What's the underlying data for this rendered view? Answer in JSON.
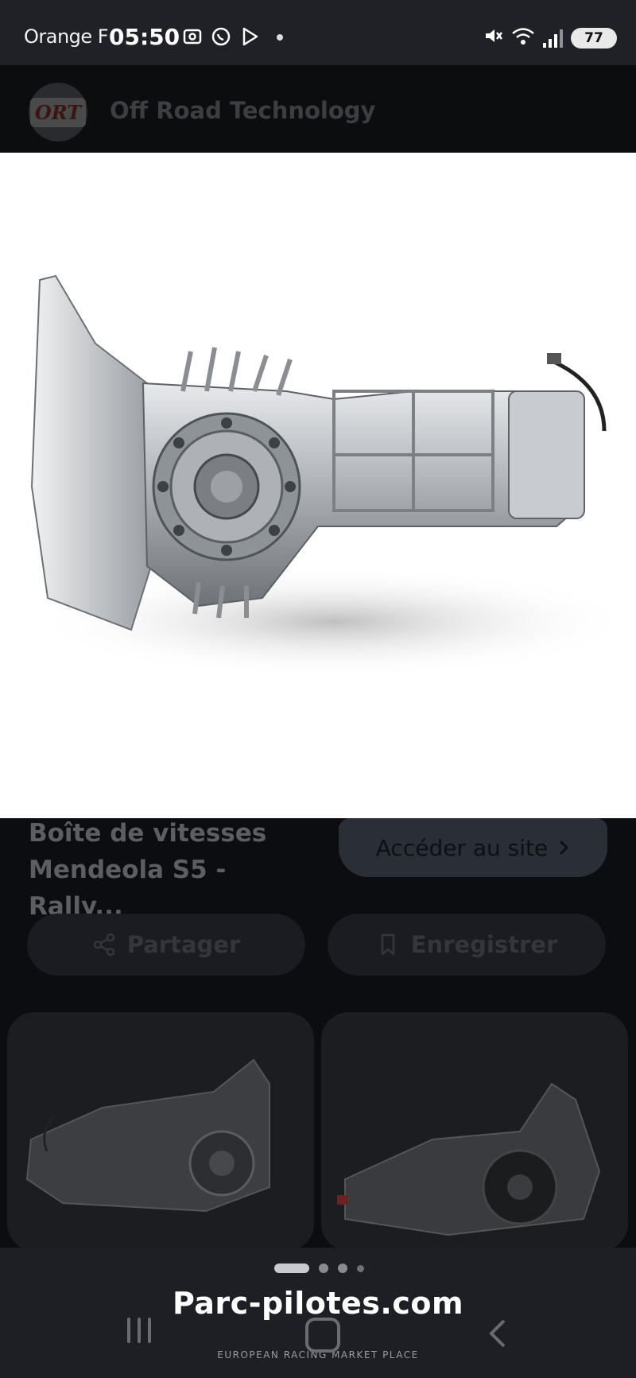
{
  "status_bar": {
    "carrier": "Orange F",
    "time": "05:50",
    "battery": "77"
  },
  "header": {
    "logo_text": "ORT",
    "site_name": "Off Road Technology"
  },
  "result": {
    "title_line1": "Boîte de vitesses",
    "title_line2": "Mendeola S5 - Rally...",
    "visit_button": "Accéder au site",
    "share_button": "Partager",
    "save_button": "Enregistrer"
  },
  "pager": {
    "pages": 4,
    "current": 1
  },
  "watermark": {
    "brand": "Parc-pilotes.com",
    "tagline": "EUROPEAN RACING MARKET PLACE"
  },
  "colors": {
    "background": "#0e0f12",
    "status_bar": "#1f2126",
    "hero_background": "#ffffff",
    "pill_background": "#1a1c22"
  },
  "icons": [
    "photo-icon",
    "whatsapp-icon",
    "play-store-icon",
    "mute-icon",
    "wifi-icon",
    "signal-icon",
    "battery-icon",
    "share-icon",
    "bookmark-icon",
    "chevron-right-icon",
    "recent-apps-icon",
    "home-icon",
    "back-icon"
  ]
}
